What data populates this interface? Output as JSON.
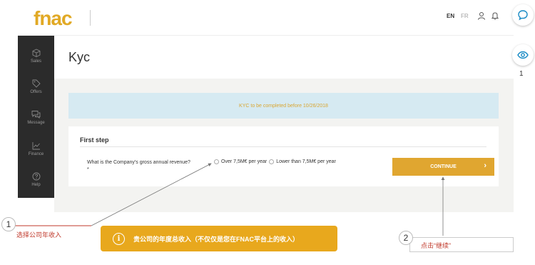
{
  "header": {
    "logo": "fnac",
    "lang_en": "EN",
    "lang_fr": "FR",
    "user_icon": "user-icon",
    "bell_icon": "bell-icon"
  },
  "floating": {
    "chat_icon": "chat-bubble-icon",
    "eye_icon": "eye-icon",
    "eye_count": "1"
  },
  "sidebar": {
    "items": [
      {
        "label": "Sales",
        "icon": "box-icon"
      },
      {
        "label": "Offers",
        "icon": "tag-icon"
      },
      {
        "label": "Message",
        "icon": "message-icon"
      },
      {
        "label": "Finance",
        "icon": "chart-icon"
      },
      {
        "label": "Help",
        "icon": "help-icon"
      }
    ]
  },
  "main": {
    "title": "Kyc",
    "banner": "KYC to be completed before 10/26/2018",
    "step_title": "First step",
    "question": "What is the Company's gross annual revenue?",
    "required_mark": "*",
    "options": [
      "Over 7,5M€ per year",
      "Lower than 7,5M€ per year"
    ],
    "continue_label": "CONTINUE"
  },
  "annotations": {
    "num1": "1",
    "note1": "选择公司年收入",
    "num2": "2",
    "note2": "点击“继续”",
    "info": "贵公司的年度总收入（不仅仅是您在FNAC平台上的收入）",
    "accent": "#e8a81d",
    "arrow_color": "#c0392b"
  }
}
